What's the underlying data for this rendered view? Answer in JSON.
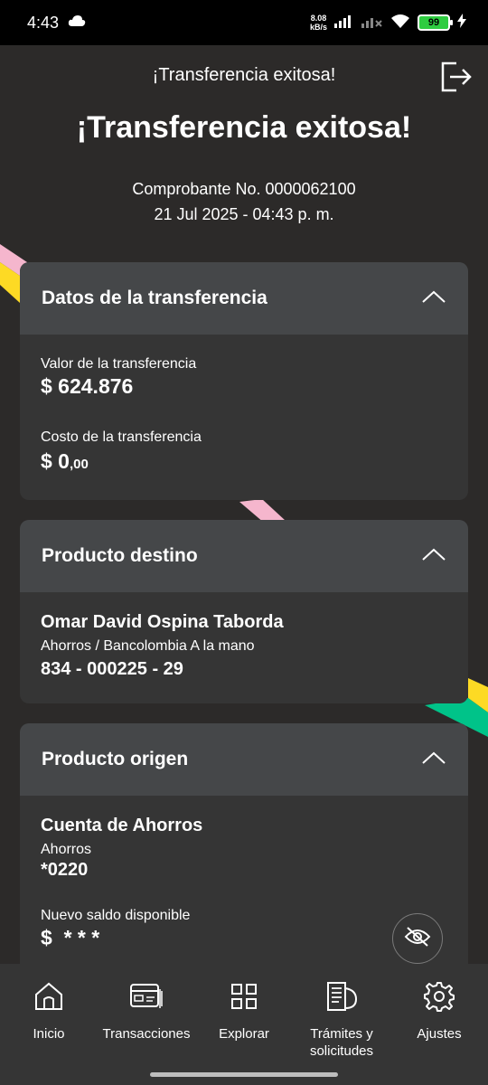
{
  "status_bar": {
    "time": "4:43",
    "net_speed_value": "8.08",
    "net_speed_unit": "kB/s",
    "battery": "99"
  },
  "header": {
    "small_title": "¡Transferencia exitosa!",
    "big_title": "¡Transferencia exitosa!",
    "receipt": "Comprobante No. 0000062100",
    "datetime": "21 Jul 2025 - 04:43 p. m."
  },
  "transfer_card": {
    "title": "Datos de la transferencia",
    "amount_label": "Valor de la transferencia",
    "amount_value": "$ 624.876",
    "cost_label": "Costo de la transferencia",
    "cost_main": "$ 0",
    "cost_cents": ",00"
  },
  "destination_card": {
    "title": "Producto destino",
    "name": "Omar David Ospina Taborda",
    "account_type": "Ahorros / Bancolombia A la mano",
    "account_number": "834 - 000225 - 29"
  },
  "origin_card": {
    "title": "Producto origen",
    "name": "Cuenta de Ahorros",
    "account_type": "Ahorros",
    "account_number": "*0220",
    "balance_label": "Nuevo saldo disponible",
    "balance_value": "$  * * *"
  },
  "bottom_nav": {
    "items": [
      {
        "label": "Inicio",
        "icon": "home-icon"
      },
      {
        "label": "Transacciones",
        "icon": "card-transfer-icon"
      },
      {
        "label": "Explorar",
        "icon": "grid-icon"
      },
      {
        "label": "Trámites y solicitudes",
        "icon": "documents-icon"
      },
      {
        "label": "Ajustes",
        "icon": "gear-icon"
      }
    ]
  },
  "colors": {
    "background": "#2c2a29",
    "card": "#353535",
    "card_header": "#454749",
    "ribbon_yellow": "#fdda24",
    "ribbon_pink": "#f5b6cd",
    "ribbon_green": "#00c389"
  }
}
